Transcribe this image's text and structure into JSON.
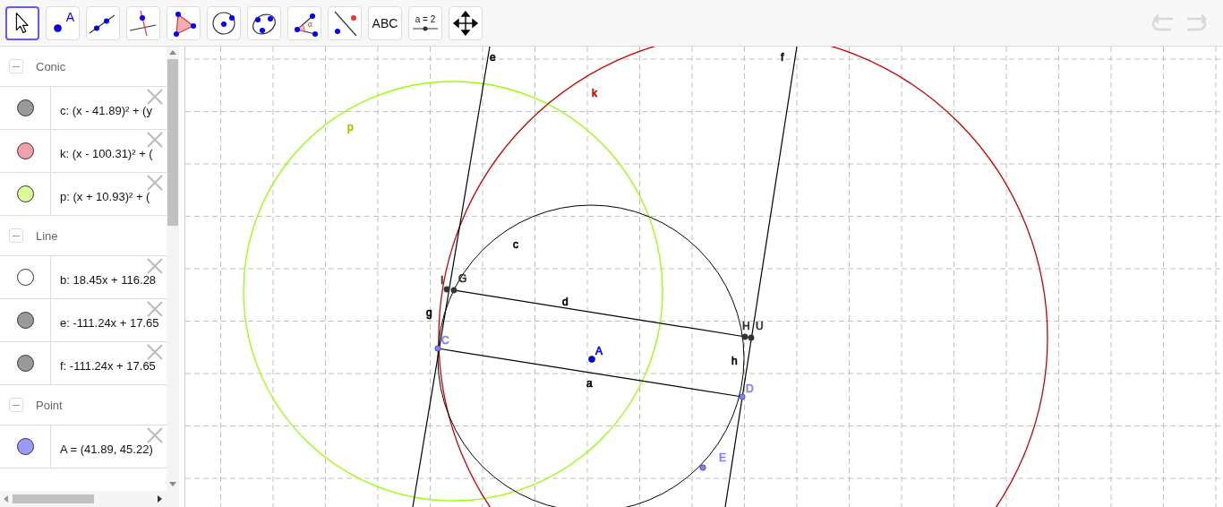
{
  "toolbar": {
    "tools": [
      {
        "kind": "move",
        "selected": true
      },
      {
        "kind": "point",
        "selected": false,
        "label": "A"
      },
      {
        "kind": "line",
        "selected": false
      },
      {
        "kind": "perpendicular",
        "selected": false
      },
      {
        "kind": "polygon",
        "selected": false
      },
      {
        "kind": "circle",
        "selected": false
      },
      {
        "kind": "conic",
        "selected": false
      },
      {
        "kind": "angle",
        "selected": false,
        "label": "α"
      },
      {
        "kind": "reflect",
        "selected": false
      },
      {
        "kind": "text",
        "selected": false,
        "label": "ABC"
      },
      {
        "kind": "slider",
        "selected": false,
        "label": "a = 2"
      },
      {
        "kind": "pan",
        "selected": false
      }
    ],
    "undo": {
      "disabled": true
    },
    "redo": {
      "disabled": true
    }
  },
  "algebra": {
    "groups": [
      {
        "title": "Conic",
        "expanded": true,
        "items": [
          {
            "text": "c: (x - 41.89)² + (y",
            "visible": true,
            "color": "#999999"
          },
          {
            "text": "k: (x - 100.31)² + (",
            "visible": true,
            "color": "#f0a0a8"
          },
          {
            "text": "p: (x + 10.93)² + (",
            "visible": true,
            "color": "#d9ff99"
          }
        ]
      },
      {
        "title": "Line",
        "expanded": true,
        "items": [
          {
            "text": "b: 18.45x + 116.28",
            "visible": false,
            "color": "#333333"
          },
          {
            "text": "e: -111.24x + 17.65",
            "visible": true,
            "color": "#999999"
          },
          {
            "text": "f: -111.24x + 17.65",
            "visible": true,
            "color": "#999999"
          }
        ]
      },
      {
        "title": "Point",
        "expanded": true,
        "items": [
          {
            "text": "A = (41.89, 45.22)",
            "visible": true,
            "color": "#9999ff"
          }
        ]
      }
    ]
  },
  "canvas": {
    "labels": [
      {
        "text": "e",
        "color": "#000000"
      },
      {
        "text": "f",
        "color": "#000000"
      },
      {
        "text": "k",
        "color": "#cc0000"
      },
      {
        "text": "p",
        "color": "#99cc00"
      },
      {
        "text": "c",
        "color": "#000000"
      },
      {
        "text": "I",
        "color": "#333333"
      },
      {
        "text": "G",
        "color": "#333333"
      },
      {
        "text": "d",
        "color": "#000000"
      },
      {
        "text": "g",
        "color": "#000000"
      },
      {
        "text": "H",
        "color": "#333333"
      },
      {
        "text": "U",
        "color": "#333333"
      },
      {
        "text": "h",
        "color": "#000000"
      },
      {
        "text": "A",
        "color": "#0000ff"
      },
      {
        "text": "C",
        "color": "#7f7fff"
      },
      {
        "text": "a",
        "color": "#000000"
      },
      {
        "text": "D",
        "color": "#7f7fff"
      },
      {
        "text": "E",
        "color": "#7f7fff"
      }
    ]
  }
}
